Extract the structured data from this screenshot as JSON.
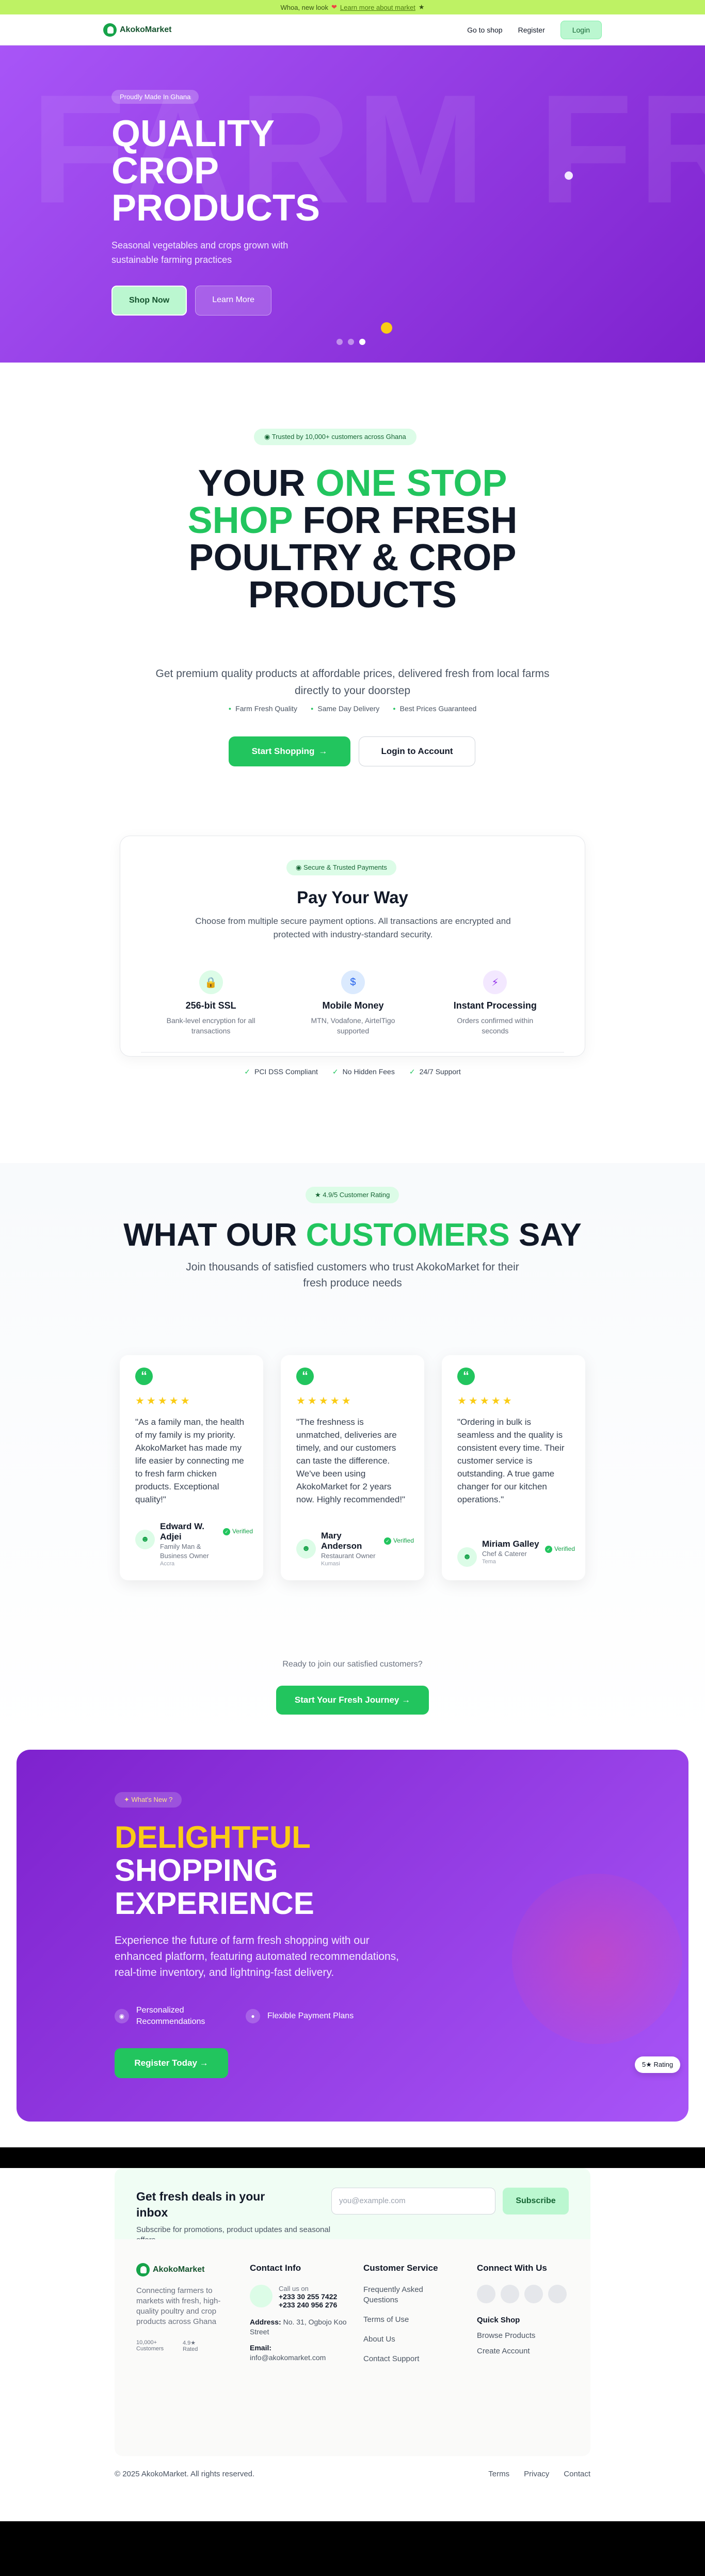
{
  "topbar": {
    "text": "Whoa, new look",
    "link": "Learn more about market"
  },
  "nav": {
    "brand": "AkokoMarket",
    "shop": "Go to shop",
    "register": "Register",
    "login": "Login"
  },
  "hero": {
    "badge": "Proudly Made In Ghana",
    "bg_word": "FARM FRES",
    "title": "QUALITY CROP PRODUCTS",
    "subtitle": "Seasonal vegetables and crops grown with sustainable farming practices",
    "shop": "Shop Now",
    "learn": "Learn More",
    "slides": 3,
    "active_slide": 3
  },
  "intro": {
    "trust": "Trusted by 10,000+ customers across Ghana",
    "h_a": "YOUR ",
    "h_b": "ONE STOP SHOP",
    "h_c": " FOR FRESH POULTRY & CROP PRODUCTS",
    "subtitle": "Get premium quality products at affordable prices, delivered fresh from local farms directly to your doorstep",
    "features": [
      "Farm Fresh Quality",
      "Same Day Delivery",
      "Best Prices Guaranteed"
    ],
    "start": "Start Shopping",
    "start_arrow": "→",
    "login": "Login to Account"
  },
  "pay": {
    "badge": "Secure & Trusted Payments",
    "title": "Pay Your Way",
    "desc": "Choose from multiple secure payment options. All transactions are encrypted and protected with industry-standard security.",
    "cols": [
      {
        "icon": "lock-icon",
        "glyph": "🔒",
        "title": "256-bit SSL",
        "desc": "Bank-level encryption for all transactions",
        "bg": "#dcfce7",
        "fg": "#16a34a"
      },
      {
        "icon": "dollar-icon",
        "glyph": "$",
        "title": "Mobile Money",
        "desc": "MTN, Vodafone, AirtelTigo supported",
        "bg": "#dbeafe",
        "fg": "#2563eb"
      },
      {
        "icon": "lightning-icon",
        "glyph": "⚡",
        "title": "Instant Processing",
        "desc": "Orders confirmed within seconds",
        "bg": "#f3e8ff",
        "fg": "#9333ea"
      }
    ],
    "badges": [
      "PCI DSS Compliant",
      "No Hidden Fees",
      "24/7 Support"
    ]
  },
  "testimonials": {
    "rating": "4.9/5 Customer Rating",
    "h_a": "WHAT OUR ",
    "h_b": "CUSTOMERS",
    "h_c": " SAY",
    "subtitle": "Join thousands of satisfied customers who trust AkokoMarket for their fresh produce needs",
    "stars": "★★★★★",
    "verified": "Verified",
    "cards": [
      {
        "quote": "\"As a family man, the health of my family is my priority. AkokoMarket has made my life easier by connecting me to fresh farm chicken products. Exceptional quality!\"",
        "name": "Edward W. Adjei",
        "role": "Family Man & Business Owner",
        "loc": "Accra"
      },
      {
        "quote": "\"The freshness is unmatched, deliveries are timely, and our customers can taste the difference. We've been using AkokoMarket for 2 years now. Highly recommended!\"",
        "name": "Mary Anderson",
        "role": "Restaurant Owner",
        "loc": "Kumasi"
      },
      {
        "quote": "\"Ordering in bulk is seamless and the quality is consistent every time. Their customer service is outstanding. A true game changer for our kitchen operations.\"",
        "name": "Miriam Galley",
        "role": "Chef & Caterer",
        "loc": "Tema"
      }
    ],
    "ready": "Ready to join our satisfied customers?",
    "journey": "Start Your Fresh Journey →"
  },
  "promo": {
    "badge": "What's New ?",
    "h_a": "DELIGHTFUL",
    "h_b": "SHOPPING EXPERIENCE",
    "desc": "Experience the future of farm fresh shopping with our enhanced platform, featuring automated recommendations, real-time inventory, and lightning-fast delivery.",
    "f1": "Personalized Recommendations",
    "f2": "Flexible Payment Plans",
    "register": "Register Today →",
    "rating_btn": "5★ Rating"
  },
  "newsletter": {
    "title": "Get fresh deals in your inbox",
    "desc": "Subscribe for promotions, product updates and seasonal offers.",
    "placeholder": "you@example.com",
    "subscribe": "Subscribe"
  },
  "footer": {
    "brand": "AkokoMarket",
    "tag": "Connecting farmers to markets with fresh, high-quality poultry and crop products across Ghana",
    "stat1": "10,000+ Customers",
    "stat2": "4.9★ Rated",
    "contact_h": "Contact Info",
    "call": "Call us on",
    "p1": "+233 30 255 7422",
    "p2": "+233 240 956 276",
    "addr_l": "Address:",
    "addr": "No. 31, Ogbojo Koo Street",
    "email_l": "Email:",
    "email": "info@akokomarket.com",
    "cs_h": "Customer Service",
    "cs": [
      "Frequently Asked Questions",
      "Terms of Use",
      "About Us",
      "Contact Support"
    ],
    "con_h": "Connect With Us",
    "quick_h": "Quick Shop",
    "quick": [
      "Browse Products",
      "Create Account"
    ],
    "copy": "© 2025 AkokoMarket. All rights reserved.",
    "links": [
      "Terms",
      "Privacy",
      "Contact"
    ]
  }
}
